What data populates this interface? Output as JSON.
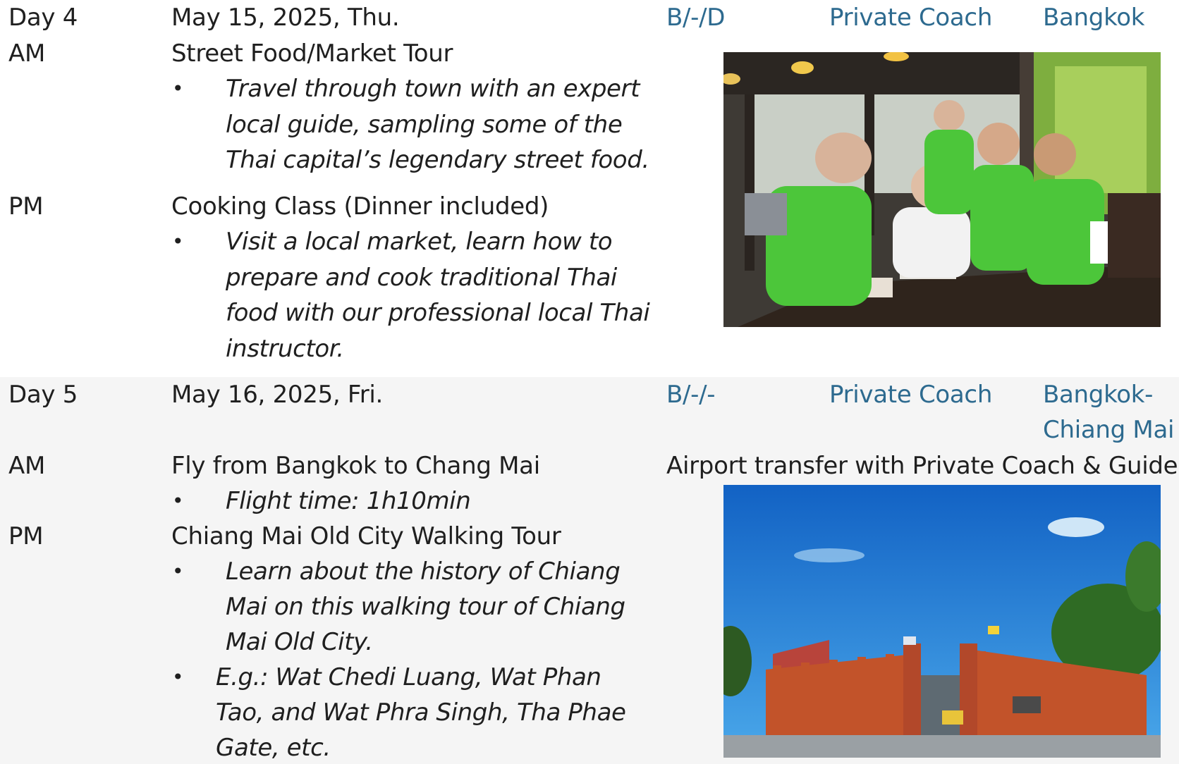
{
  "days": [
    {
      "day_label": "Day 4",
      "date": "May 15, 2025, Thu.",
      "meals": "B/-/D",
      "transport": "Private Coach",
      "location_lines": [
        "Bangkok"
      ],
      "am_label": "AM",
      "am_title": "Street Food/Market Tour",
      "am_bullets": [
        [
          "Travel through town with an expert",
          "local guide, sampling some of the",
          "Thai capital’s legendary street food."
        ]
      ],
      "pm_label": "PM",
      "pm_title": "Cooking Class (Dinner included)",
      "pm_bullets": [
        [
          "Visit a local market, learn how to",
          "prepare and cook traditional Thai",
          "food with our professional local Thai",
          "instructor."
        ]
      ],
      "photo_icon": "cooking-class-photo"
    },
    {
      "day_label": "Day 5",
      "date": "May 16, 2025, Fri.",
      "meals": "B/-/-",
      "transport": "Private Coach",
      "location_lines": [
        "Bangkok-",
        "Chiang Mai"
      ],
      "am_label": "AM",
      "am_title": "Fly from Bangkok to Chang Mai",
      "am_note": "Airport transfer with Private Coach & Guide",
      "am_bullets": [
        [
          "Flight time: 1h10min"
        ]
      ],
      "pm_label": "PM",
      "pm_title": "Chiang Mai Old City Walking Tour",
      "pm_bullets": [
        [
          "Learn about the history of Chiang",
          "Mai on this walking tour of Chiang",
          "Mai Old City."
        ],
        [
          "E.g.:  Wat Chedi Luang, Wat Phan",
          "Tao, and Wat Phra Singh, Tha Phae",
          "Gate, etc."
        ]
      ],
      "photo_icon": "old-city-gate-photo"
    }
  ],
  "bullet_char": "•",
  "colors": {
    "accent": "#2d6a8f",
    "text": "#1f1f1f",
    "alt_row": "#f5f5f5",
    "apron_green": "#4cc63a",
    "sky_blue": "#1f86d6",
    "brick": "#c2532a"
  }
}
